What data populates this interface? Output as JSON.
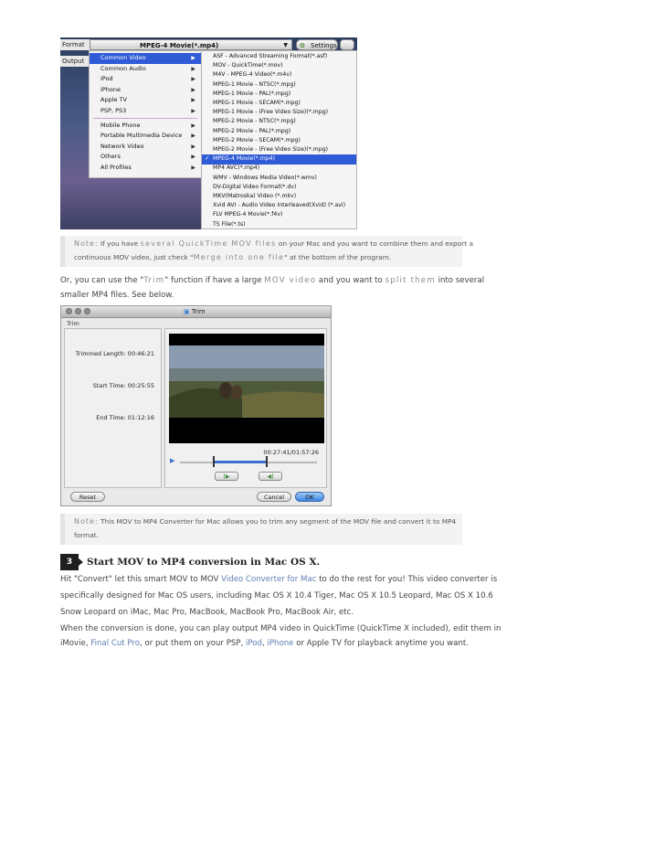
{
  "screenshot1": {
    "format_label": "Format",
    "output_label": "Output",
    "format_value": "MPEG-4 Movie(*.mp4)",
    "settings_label": "Settings",
    "categories": [
      "Common Video",
      "Common Audio",
      "iPod",
      "iPhone",
      "Apple TV",
      "PSP, PS3",
      "Mobile Phone",
      "Portable Multimedia Device",
      "Network Video",
      "Others",
      "All Profiles"
    ],
    "formats": [
      "ASF - Advanced Streaming Format(*.asf)",
      "MOV - QuickTime(*.mov)",
      "M4V - MPEG-4 Video(*.m4v)",
      "MPEG-1 Movie - NTSC(*.mpg)",
      "MPEG-1 Movie - PAL(*.mpg)",
      "MPEG-1 Movie - SECAM(*.mpg)",
      "MPEG-1 Movie - (Free Video Size)(*.mpg)",
      "MPEG-2 Movie - NTSC(*.mpg)",
      "MPEG-2 Movie - PAL(*.mpg)",
      "MPEG-2 Movie - SECAM(*.mpg)",
      "MPEG-2 Movie - (Free Video Size)(*.mpg)",
      "MPEG-4 Movie(*.mp4)",
      "MP4 AVC(*.mp4)",
      "WMV - Windows Media Video(*.wmv)",
      "DV-Digital Video Format(*.dv)",
      "MKV(Matroska) Video (*.mkv)",
      "Xvid AVI - Audio Video Interleaved(Xvid) (*.avi)",
      "FLV MPEG-4 Movie(*.f4v)",
      "TS File(*.ts)"
    ]
  },
  "note1": {
    "label": "Note:",
    "l1_a": "If you have",
    "l1_b": "several QuickTime MOV files",
    "l1_c": "on your Mac and you want to combine them and export a",
    "l2_a": "continuous MOV video, just check \"",
    "l2_b": "Merge into one file",
    "l2_c": "\" at the bottom of the program."
  },
  "para1": {
    "l1_a": "Or, you can use the \"",
    "l1_b": "Trim",
    "l1_c": "\" function if have a large",
    "l1_d": "MOV video",
    "l1_e": "and you want to",
    "l1_f": "split them",
    "l1_g": "into several",
    "l2": "smaller MP4 files. See below."
  },
  "screenshot2": {
    "window_title": "Trim",
    "group_label": "Trim",
    "trimmed_length": "Trimmed Length: 00:46:21",
    "start_time": "Start Time: 00:25:55",
    "end_time": "End Time: 01:12:16",
    "timecode": "00:27:41/01:57:26",
    "reset_label": "Reset",
    "cancel_label": "Cancel",
    "ok_label": "OK"
  },
  "note2": {
    "label": "Note:",
    "l1": "This MOV to MP4 Converter for Mac allows you to trim any segment of the MOV file and convert it to MP4",
    "l2": "format."
  },
  "step": {
    "number": "3",
    "title": "Start MOV to MP4 conversion in Mac OS X."
  },
  "para2": {
    "l1_a": "Hit \"Convert\" let this smart MOV to MOV",
    "l1_link": "Video Converter for Mac",
    "l1_b": "to do the rest for you! This video converter is",
    "l2": "specifically designed for Mac OS users, including Mac OS X 10.4 Tiger, Mac OS X 10.5 Leopard, Mac OS X 10.6",
    "l3": "Snow Leopard on iMac, Mac Pro, MacBook, MacBook Pro, MacBook Air, etc."
  },
  "para3": {
    "l1": "When the conversion is done, you can play output MP4 video in QuickTime (QuickTime X included), edit them in",
    "l2_a": "iMovie,",
    "l2_link1": "Final Cut Pro",
    "l2_b": ", or put them on your PSP,",
    "l2_link2": "iPod",
    "l2_c": ",",
    "l2_link3": "iPhone",
    "l2_d": "or Apple TV for playback anytime you want."
  },
  "colors": {
    "link": "#5f7fb5",
    "menu_highlight": "#2f5bd7",
    "note_bg": "#f3f3f3"
  }
}
